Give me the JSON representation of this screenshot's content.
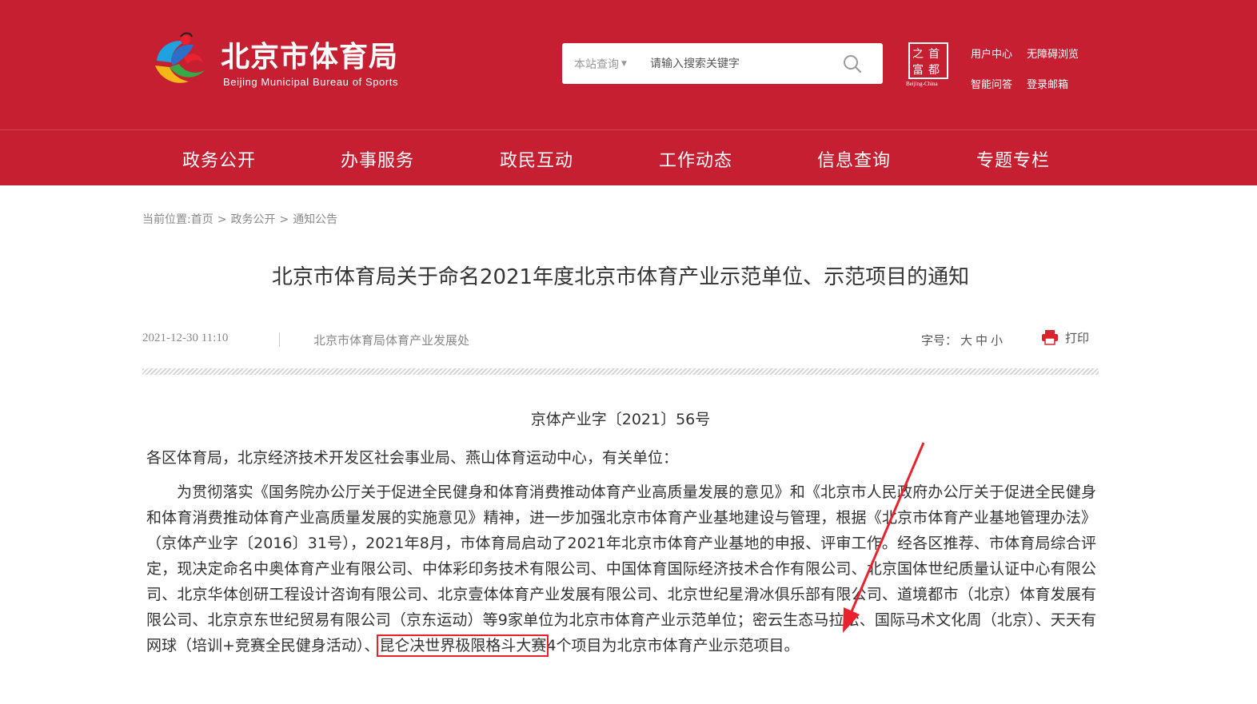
{
  "header": {
    "site_name": "北京市体育局",
    "site_name_en": "Beijing Municipal Bureau of Sports",
    "search": {
      "scope_label": "本站查询",
      "placeholder": "请输入搜索关键字"
    },
    "capital_logo_text": "Beijing-China",
    "links": [
      "用户中心",
      "无障碍浏览",
      "智能问答",
      "登录邮箱"
    ]
  },
  "nav": {
    "items": [
      "政务公开",
      "办事服务",
      "政民互动",
      "工作动态",
      "信息查询",
      "专题专栏"
    ]
  },
  "breadcrumb": {
    "prefix": "当前位置:",
    "items": [
      "首页",
      "政务公开",
      "通知公告"
    ],
    "separator": ">"
  },
  "article": {
    "title": "北京市体育局关于命名2021年度北京市体育产业示范单位、示范项目的通知",
    "date": "2021-12-30 11:10",
    "source": "北京市体育局体育产业发展处",
    "font_size_label": "字号：",
    "font_size_options": [
      "大",
      "中",
      "小"
    ],
    "print_label": "打印",
    "doc_number": "京体产业字〔2021〕56号",
    "salutation": "各区体育局，北京经济技术开发区社会事业局、燕山体育运动中心，有关单位：",
    "body_before_highlight": "为贯彻落实《国务院办公厅关于促进全民健身和体育消费推动体育产业高质量发展的意见》和《北京市人民政府办公厅关于促进全民健身和体育消费推动体育产业高质量发展的实施意见》精神，进一步加强北京市体育产业基地建设与管理，根据《北京市体育产业基地管理办法》（京体产业字〔2016〕31号），2021年8月，市体育局启动了2021年北京市体育产业基地的申报、评审工作。经各区推荐、市体育局综合评定，现决定命名中奥体育产业有限公司、中体彩印务技术有限公司、中国体育国际经济技术合作有限公司、北京国体世纪质量认证中心有限公司、北京华体创研工程设计咨询有限公司、北京壹体体育产业发展有限公司、北京世纪星滑冰俱乐部有限公司、道境都市（北京）体育发展有限公司、北京京东世纪贸易有限公司（京东运动）等9家单位为北京市体育产业示范单位；密云生态马拉松、国际马术文化周（北京）、天天有网球（培训+竞赛全民健身活动）、",
    "body_highlight": "昆仑决世界极限格斗大赛",
    "body_after_highlight": "4个项目为北京市体育产业示范项目。"
  },
  "colors": {
    "brand_red": "#c51f31",
    "annotation_red": "#e8232d"
  },
  "icons": [
    "search-icon",
    "printer-icon",
    "sports-logo-icon",
    "capital-logo-icon",
    "annotation-arrow"
  ]
}
